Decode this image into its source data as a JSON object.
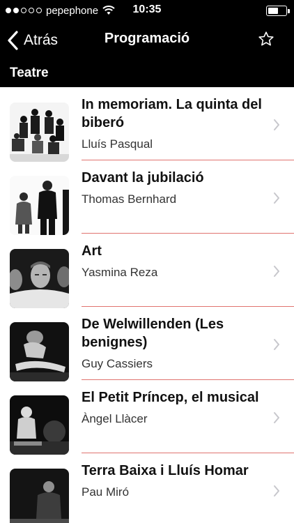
{
  "status_bar": {
    "carrier": "pepephone",
    "time": "10:35",
    "signal_bars": 2,
    "signal_total": 5,
    "battery_level": 0.65,
    "icons": [
      "signal-dots-icon",
      "wifi-icon",
      "battery-icon"
    ]
  },
  "nav": {
    "back_label": "Atrás",
    "title": "Programació",
    "back_icon": "chevron-left-icon",
    "favorite_icon": "star-outline-icon"
  },
  "section": {
    "title": "Teatre"
  },
  "colors": {
    "bar_background": "#000000",
    "separator": "#e0736f",
    "chevron": "#c7c7cc"
  },
  "items": [
    {
      "title": "In memoriam. La quinta del biberó",
      "author": "Lluís Pasqual",
      "thumb_icon": "group-photo-thumbnail"
    },
    {
      "title": "Davant la jubilació",
      "author": "Thomas Bernhard",
      "thumb_icon": "actors-photo-thumbnail"
    },
    {
      "title": "Art",
      "author": "Yasmina Reza",
      "thumb_icon": "portraits-photo-thumbnail"
    },
    {
      "title": "De Welwillenden (Les benignes)",
      "author": "Guy Cassiers",
      "thumb_icon": "stage-photo-thumbnail"
    },
    {
      "title": "El Petit Príncep, el musical",
      "author": "Àngel Llàcer",
      "thumb_icon": "musical-photo-thumbnail"
    },
    {
      "title": "Terra Baixa i Lluís Homar",
      "author": "Pau Miró",
      "thumb_icon": "actor-photo-thumbnail"
    }
  ]
}
